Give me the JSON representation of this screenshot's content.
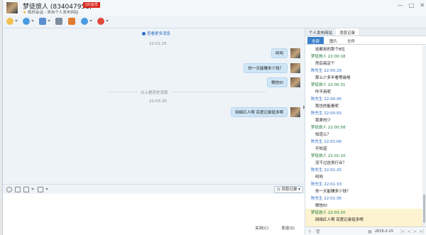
{
  "window": {
    "contact_name": "梦徒旅人 (834047951)",
    "badge": "QQ会员",
    "subtitle": "临时会话 - 来自个人发布网站",
    "controls": [
      "—",
      "□",
      "✕"
    ]
  },
  "chat": {
    "load_more": "查看更多消息",
    "messages": [
      {
        "time": "22:01:25"
      },
      {
        "text": "呵呵"
      },
      {
        "text": "你一天能赚多少钱？"
      },
      {
        "text": "微信ID"
      }
    ],
    "divider": "以上是历史消息",
    "time2": "22:03:20",
    "last_message": "网络红人啊 百度记录挺多啊"
  },
  "input_bar": {
    "message_record_button": "消息记录"
  },
  "send": {
    "close_label": "关闭(C)",
    "send_label": "发送(S)"
  },
  "right_panel": {
    "tabs": [
      "个人发布网站",
      "消息记录"
    ],
    "subtabs": [
      "全部",
      "图片",
      "文件"
    ],
    "history": [
      {
        "kind": "text",
        "text": "这都用的那个8位"
      },
      {
        "kind": "meta",
        "who": "me",
        "text": "梦徒旅人 22:00:18"
      },
      {
        "kind": "text",
        "text": "然后搞定个"
      },
      {
        "kind": "meta",
        "who": "other",
        "text": "陈先生 22:00:29"
      },
      {
        "kind": "text",
        "text": "那么少多半看等级咯"
      },
      {
        "kind": "meta",
        "who": "me",
        "text": "梦徒旅人 22:00:31"
      },
      {
        "kind": "text",
        "text": "咋不用呢"
      },
      {
        "kind": "meta",
        "who": "other",
        "text": "陈先生 22:00:45"
      },
      {
        "kind": "text",
        "text": "我也的能看呢"
      },
      {
        "kind": "meta",
        "who": "other",
        "text": "陈先生 22:00:55"
      },
      {
        "kind": "text",
        "text": "我拿的少"
      },
      {
        "kind": "meta",
        "who": "me",
        "text": "梦徒旅人 22:00:58"
      },
      {
        "kind": "text",
        "text": "知道么？"
      },
      {
        "kind": "meta",
        "who": "other",
        "text": "陈先生 22:01:06"
      },
      {
        "kind": "text",
        "text": "不知道"
      },
      {
        "kind": "meta",
        "who": "me",
        "text": "梦徒旅人 22:01:10"
      },
      {
        "kind": "text",
        "text": "没干过这类行业？"
      },
      {
        "kind": "meta",
        "who": "other",
        "text": "陈先生 22:01:25"
      },
      {
        "kind": "text",
        "text": "呵呵"
      },
      {
        "kind": "meta",
        "who": "other",
        "text": "陈先生 22:01:33"
      },
      {
        "kind": "text",
        "text": "你一天能赚多少钱？"
      },
      {
        "kind": "meta",
        "who": "other",
        "text": "陈先生 22:01:36"
      },
      {
        "kind": "text",
        "text": "微信ID"
      },
      {
        "kind": "meta",
        "who": "me",
        "text": "梦徒旅人 22:03:20"
      },
      {
        "kind": "text",
        "text": "网络红人啊 百度记录挺多啊"
      }
    ],
    "footer_date": "2015-2-15"
  },
  "colors": {
    "accent": "#3a7fc9",
    "bubble": "#cfe6f7",
    "highlight": "#fdf3d0",
    "me_name": "#1e7a3c",
    "other_name": "#2b6cc4"
  }
}
